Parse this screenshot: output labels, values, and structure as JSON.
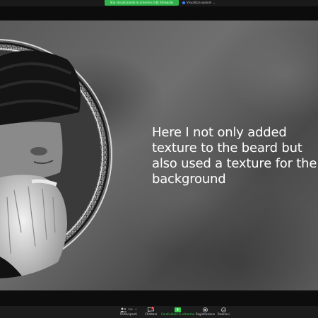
{
  "topbar": {
    "share_notice": "Stai visualizzando lo schermo di JK Ahluwalia",
    "view_options": "Visualizza opzioni"
  },
  "slide": {
    "text": "Here I not only added\ntexture to the beard but\nalso used a texture for the\nbackground"
  },
  "toolbar": {
    "participants": {
      "label": "Partecipanti",
      "count": "114"
    },
    "chat": {
      "label": "Chattare",
      "badge": "5"
    },
    "share": {
      "label": "Condividere lo schermo"
    },
    "record": {
      "label": "Registrazione"
    },
    "reactions": {
      "label": "Reazioni"
    }
  },
  "colors": {
    "share_green": "#2fb34a",
    "badge_red": "#e02424",
    "toolbar_bg": "#1c1c1c"
  }
}
